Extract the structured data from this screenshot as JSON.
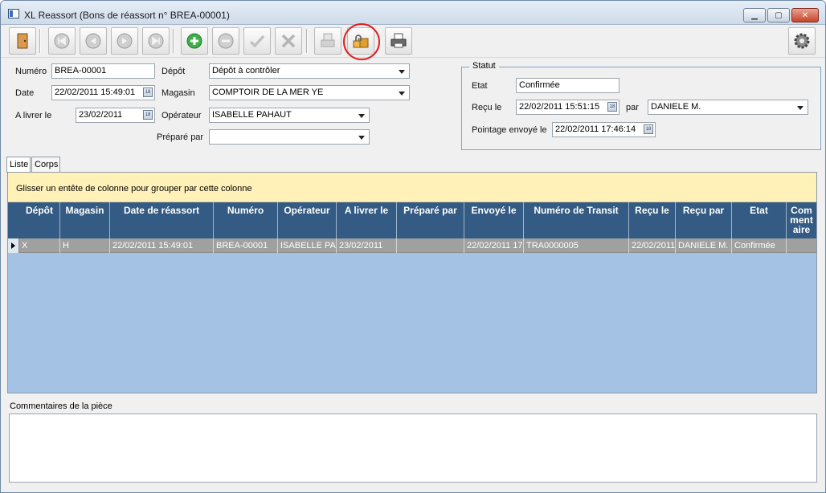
{
  "window": {
    "title": "XL Reassort (Bons de réassort n° BREA-00001)",
    "minimize": "▁",
    "maximize": "▢",
    "close": "✕"
  },
  "toolbar": {
    "buttons": [
      {
        "name": "exit-door-icon"
      },
      {
        "name": "first-record-icon"
      },
      {
        "name": "previous-record-icon"
      },
      {
        "name": "next-record-icon"
      },
      {
        "name": "last-record-icon"
      },
      {
        "name": "add-icon"
      },
      {
        "name": "remove-icon"
      },
      {
        "name": "validate-check-icon"
      },
      {
        "name": "cancel-x-icon"
      },
      {
        "name": "printer-disabled-icon"
      },
      {
        "name": "lock-boxes-icon"
      },
      {
        "name": "print-icon"
      },
      {
        "name": "settings-gear-icon"
      }
    ]
  },
  "form": {
    "numero_label": "Numéro",
    "numero_value": "BREA-00001",
    "date_label": "Date",
    "date_value": "22/02/2011 15:49:01",
    "alivrer_label": "A livrer le",
    "alivrer_value": "23/02/2011",
    "depot_label": "Dépôt",
    "depot_value": "Dépôt à contrôler",
    "magasin_label": "Magasin",
    "magasin_value": "COMPTOIR DE LA MER YE",
    "operateur_label": "Opérateur",
    "operateur_value": "ISABELLE PAHAUT",
    "prepare_label": "Préparé par",
    "prepare_value": "",
    "cal_glyph": "18"
  },
  "statut": {
    "title": "Statut",
    "etat_label": "Etat",
    "etat_value": "Confirmée",
    "recu_label": "Reçu le",
    "recu_value": "22/02/2011 15:51:15",
    "par_label": "par",
    "par_value": "DANIELE M.",
    "pointage_label": "Pointage envoyé le",
    "pointage_value": "22/02/2011 17:46:14"
  },
  "tabs": [
    "Liste",
    "Corps"
  ],
  "grid": {
    "group_hint": "Glisser un entête de colonne pour grouper par cette colonne",
    "columns": [
      "Dépôt",
      "Magasin",
      "Date de réassort",
      "Numéro",
      "Opérateur",
      "A livrer le",
      "Préparé par",
      "Envoyé le",
      "Numéro de Transit",
      "Reçu le",
      "Reçu par",
      "Etat",
      "Com ment aire"
    ],
    "rows": [
      [
        "X",
        "H",
        "22/02/2011 15:49:01",
        "BREA-00001",
        "ISABELLE PAH.",
        "23/02/2011",
        "",
        "22/02/2011 17",
        "TRA0000005",
        "22/02/2011",
        "DANIELE M.",
        "Confirmée",
        ""
      ]
    ]
  },
  "comments": {
    "label": "Commentaires de la pièce",
    "value": ""
  }
}
